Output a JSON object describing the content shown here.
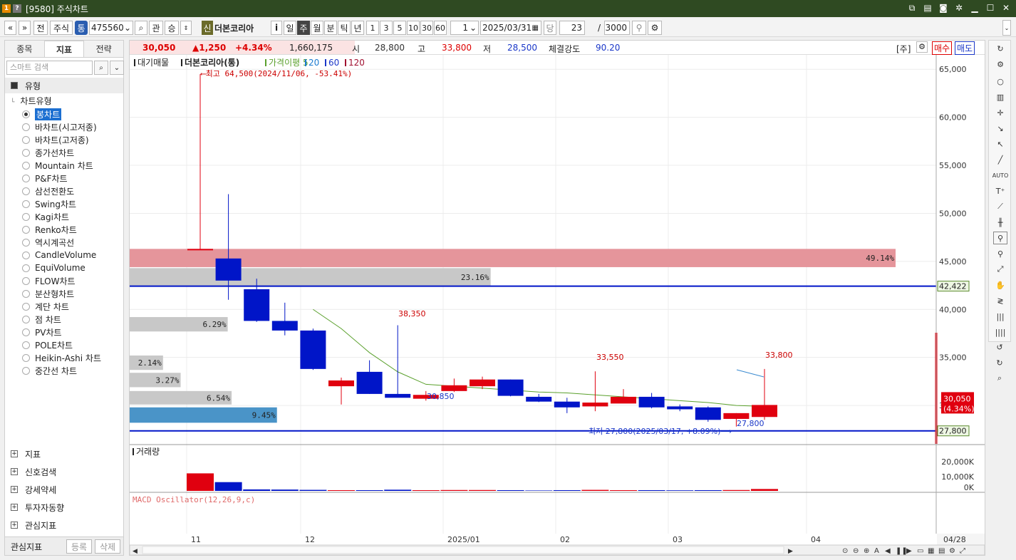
{
  "window": {
    "title": "[9580] 주식차트",
    "icon1": "1",
    "icon2": "?"
  },
  "toolbar": {
    "prev": "«",
    "next": "»",
    "all": "전",
    "market": "주식",
    "tong": "통",
    "code": "475560",
    "search": "⌕",
    "gwan": "관",
    "up": "승",
    "new": "신",
    "stock_name": "더본코리아",
    "info": "i",
    "periods": [
      "일",
      "주",
      "월",
      "분",
      "틱",
      "년"
    ],
    "active_period": "주",
    "intervals": [
      "1",
      "3",
      "5",
      "10",
      "30",
      "60"
    ],
    "count": "1",
    "date": "2025/03/31",
    "dang": "당",
    "num": "23",
    "slash": "/",
    "total": "3000"
  },
  "left_panel": {
    "tabs": [
      "종목",
      "지표",
      "전략"
    ],
    "active_tab": "지표",
    "search_placeholder": "스마트 검색",
    "section_type": "유형",
    "chart_type_label": "차트유형",
    "chart_types": [
      "봉차트",
      "바차트(시고저종)",
      "바차트(고저종)",
      "종가선차트",
      "Mountain 차트",
      "P&F차트",
      "삼선전환도",
      "Swing차트",
      "Kagi차트",
      "Renko차트",
      "역시계곡선",
      "CandleVolume",
      "EquiVolume",
      "FLOW차트",
      "분산형차트",
      "계단 차트",
      "점 차트",
      "PV차트",
      "POLE차트",
      "Heikin-Ashi 차트",
      "중간선 차트"
    ],
    "selected": "봉차트",
    "sections": [
      "지표",
      "신호검색",
      "강세약세",
      "투자자동향",
      "관심지표"
    ],
    "bottom_label": "관심지표",
    "register": "등록",
    "delete": "삭제"
  },
  "quote": {
    "price": "30,050",
    "change": "▲1,250",
    "pct": "+4.34%",
    "volume": "1,660,175",
    "open_label": "시",
    "open": "28,800",
    "high_label": "고",
    "high": "33,800",
    "low_label": "저",
    "low": "28,500",
    "strength_label": "체결강도",
    "strength": "90.20",
    "unit": "[주]",
    "buy": "매수",
    "sell": "매도"
  },
  "legend": {
    "items": [
      "대기매물",
      "더본코리아(통)",
      "가격이평 5",
      "20",
      "60",
      "120"
    ],
    "high_note": "⟵최고 64,500(2024/11/06, -53.41%)",
    "low_note": "최저 27,800(2025/03/17, +8.09%)⟶"
  },
  "colors": {
    "up": "#e0000f",
    "down": "#0015c8",
    "ma": "#5aa02c",
    "line": "#0015c8"
  },
  "chart_data": {
    "type": "candlestick",
    "x_labels": [
      "11",
      "12",
      "2025/01",
      "02",
      "03",
      "04"
    ],
    "y_ticks": [
      "65,000",
      "60,000",
      "55,000",
      "50,000",
      "45,000",
      "40,000",
      "35,000",
      "30,000"
    ],
    "ylim": [
      26000,
      66500
    ],
    "candles": [
      {
        "o": 46300,
        "h": 64500,
        "l": 46200,
        "c": 46300
      },
      {
        "o": 45300,
        "h": 52000,
        "l": 41000,
        "c": 43000
      },
      {
        "o": 42100,
        "h": 43200,
        "l": 38700,
        "c": 38800
      },
      {
        "o": 38800,
        "h": 40700,
        "l": 37300,
        "c": 37800
      },
      {
        "o": 37800,
        "h": 38000,
        "l": 33700,
        "c": 33800
      },
      {
        "o": 32000,
        "h": 32900,
        "l": 30100,
        "c": 32600
      },
      {
        "o": 33500,
        "h": 34700,
        "l": 31200,
        "c": 31200
      },
      {
        "o": 31200,
        "h": 38350,
        "l": 30850,
        "c": 30800
      },
      {
        "o": 30700,
        "h": 31500,
        "l": 30500,
        "c": 31100
      },
      {
        "o": 31500,
        "h": 32800,
        "l": 31400,
        "c": 32100
      },
      {
        "o": 32000,
        "h": 33000,
        "l": 31700,
        "c": 32700
      },
      {
        "o": 32700,
        "h": 32700,
        "l": 30950,
        "c": 31000
      },
      {
        "o": 30900,
        "h": 31200,
        "l": 30350,
        "c": 30400
      },
      {
        "o": 30400,
        "h": 30800,
        "l": 29200,
        "c": 29800
      },
      {
        "o": 29900,
        "h": 33550,
        "l": 29400,
        "c": 30300
      },
      {
        "o": 30200,
        "h": 31700,
        "l": 30300,
        "c": 30900
      },
      {
        "o": 30900,
        "h": 31300,
        "l": 29700,
        "c": 29800
      },
      {
        "o": 29900,
        "h": 30100,
        "l": 29400,
        "c": 29600
      },
      {
        "o": 29800,
        "h": 29900,
        "l": 28300,
        "c": 28500
      },
      {
        "o": 28600,
        "h": 29200,
        "l": 27800,
        "c": 29200
      },
      {
        "o": 28800,
        "h": 33800,
        "l": 28500,
        "c": 30050
      }
    ],
    "ma5": [
      null,
      null,
      null,
      null,
      40000,
      38000,
      35500,
      33500,
      32200,
      32000,
      31800,
      31600,
      31400,
      31300,
      31100,
      30900,
      30700,
      30500,
      30300,
      30000,
      29900
    ],
    "volume_profile": [
      {
        "label": "49.14%",
        "price_lo": 44400,
        "price_hi": 46300,
        "pct": 49.14,
        "color": "#e5959b"
      },
      {
        "label": "23.16%",
        "price_lo": 42400,
        "price_hi": 44300,
        "pct": 23.16,
        "color": "#c8c8c8"
      },
      {
        "label": "6.29%",
        "price_lo": 37700,
        "price_hi": 39200,
        "pct": 6.29,
        "color": "#c8c8c8"
      },
      {
        "label": "2.14%",
        "price_lo": 33700,
        "price_hi": 35200,
        "pct": 2.14,
        "color": "#c8c8c8"
      },
      {
        "label": "3.27%",
        "price_lo": 31900,
        "price_hi": 33400,
        "pct": 3.27,
        "color": "#c8c8c8"
      },
      {
        "label": "6.54%",
        "price_lo": 30100,
        "price_hi": 31500,
        "pct": 6.54,
        "color": "#c8c8c8"
      },
      {
        "label": "9.45%",
        "price_lo": 28200,
        "price_hi": 29800,
        "pct": 9.45,
        "color": "#4a94c8"
      }
    ],
    "hline_high": "42,422",
    "hline_low": "27,800",
    "current": "30,050",
    "current_pct": "(4.34%)",
    "annotations": [
      "38,350",
      "30,850",
      "33,550",
      "33,800",
      "27,800"
    ],
    "volume_title": "거래량",
    "volume_ticks": [
      "20,000K",
      "10,000K",
      "0K"
    ],
    "volumes": [
      12000,
      6000,
      1000,
      900,
      700,
      500,
      500,
      800,
      500,
      600,
      600,
      500,
      300,
      500,
      700,
      500,
      500,
      400,
      500,
      600,
      1300
    ],
    "macd_title": "MACD Oscillator(12,26,9,c)",
    "date_label": "04/28"
  }
}
